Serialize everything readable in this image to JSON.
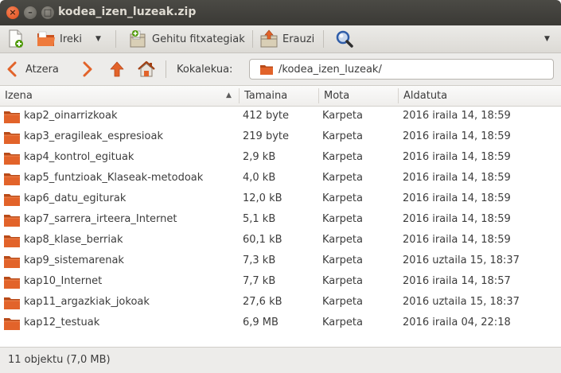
{
  "window": {
    "title": "kodea_izen_luzeak.zip"
  },
  "toolbar": {
    "new_archive_icon": "new-archive-icon",
    "open_label": "Ireki",
    "add_files_label": "Gehitu fitxategiak",
    "extract_label": "Erauzi",
    "search_icon": "search-icon"
  },
  "location": {
    "back_label": "Atzera",
    "location_label": "Kokalekua:",
    "path": "/kodea_izen_luzeak/"
  },
  "table": {
    "columns": [
      "Izena",
      "Tamaina",
      "Mota",
      "Aldatuta"
    ],
    "sort_column": "Izena",
    "rows": [
      {
        "name": "kap2_oinarrizkoak",
        "size": "412 byte",
        "type": "Karpeta",
        "modified": "2016 iraila 14, 18:59"
      },
      {
        "name": "kap3_eragileak_espresioak",
        "size": "219 byte",
        "type": "Karpeta",
        "modified": "2016 iraila 14, 18:59"
      },
      {
        "name": "kap4_kontrol_egituak",
        "size": "2,9 kB",
        "type": "Karpeta",
        "modified": "2016 iraila 14, 18:59"
      },
      {
        "name": "kap5_funtzioak_Klaseak-metodoak",
        "size": "4,0 kB",
        "type": "Karpeta",
        "modified": "2016 iraila 14, 18:59"
      },
      {
        "name": "kap6_datu_egiturak",
        "size": "12,0 kB",
        "type": "Karpeta",
        "modified": "2016 iraila 14, 18:59"
      },
      {
        "name": "kap7_sarrera_irteera_Internet",
        "size": "5,1 kB",
        "type": "Karpeta",
        "modified": "2016 iraila 14, 18:59"
      },
      {
        "name": "kap8_klase_berriak",
        "size": "60,1 kB",
        "type": "Karpeta",
        "modified": "2016 iraila 14, 18:59"
      },
      {
        "name": "kap9_sistemarenak",
        "size": "7,3 kB",
        "type": "Karpeta",
        "modified": "2016 uztaila 15, 18:37"
      },
      {
        "name": "kap10_Internet",
        "size": "7,7 kB",
        "type": "Karpeta",
        "modified": "2016 iraila 14, 18:57"
      },
      {
        "name": "kap11_argazkiak_jokoak",
        "size": "27,6 kB",
        "type": "Karpeta",
        "modified": "2016 uztaila 15, 18:37"
      },
      {
        "name": "kap12_testuak",
        "size": "6,9 MB",
        "type": "Karpeta",
        "modified": "2016 iraila 04, 22:18"
      }
    ]
  },
  "status": {
    "text": "11 objektu (7,0 MB)"
  },
  "colors": {
    "titlebar": "#3f3e3a",
    "close_button": "#df4b16",
    "folder": "#e2632a",
    "nav_arrow": "#e2632a"
  }
}
